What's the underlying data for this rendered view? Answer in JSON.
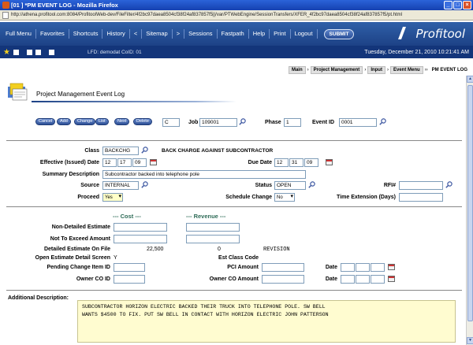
{
  "window": {
    "title": "[01 ] *PM EVENT LOG - Mozilla Firefox",
    "url": "http://athena.profitool.com:8084/ProfitoolWeb-dev/FileFilter/4f2bc97daea8504cf38f24af837857f5||/var/PTWebEngine/SessionTransfers/XFER_4f2bc97daea8504cf38f24af837857f5/pt.html"
  },
  "menu": {
    "items": [
      "Full Menu",
      "Favorites",
      "Shortcuts",
      "History",
      "<",
      "Sitemap",
      ">",
      "Sessions",
      "Fastpath",
      "Help",
      "Print",
      "Logout"
    ],
    "submit_label": "SUBMIT",
    "brand": "Profitool"
  },
  "userbar": {
    "lfd": "LFD: demodat  CoID: 01",
    "date": "Tuesday, December 21, 2010  10:21:41 AM"
  },
  "breadcrumb": [
    "Main",
    "Project Management",
    "Input",
    "Event Menu",
    "PM EVENT LOG"
  ],
  "form_title": "Project Management Event Log",
  "actions": [
    "Cancel",
    "Add",
    "Change",
    "List",
    "Next",
    "Delete"
  ],
  "header": {
    "mode_value": "C",
    "job_label": "Job",
    "job_value": "109001",
    "phase_label": "Phase",
    "phase_value": "1",
    "event_id_label": "Event ID",
    "event_id_value": "0001"
  },
  "details": {
    "class_label": "Class",
    "class_value": "BACKCHG",
    "class_desc": "BACK CHARGE AGAINST SUBCONTRACTOR",
    "effective_label": "Effective (Issued) Date",
    "effective": [
      "12",
      "17",
      "09"
    ],
    "due_label": "Due Date",
    "due": [
      "12",
      "31",
      "09"
    ],
    "summary_label": "Summary Description",
    "summary_value": "Subcontractor backed into telephone pole",
    "source_label": "Source",
    "source_value": "INTERNAL",
    "status_label": "Status",
    "status_value": "OPEN",
    "rfi_label": "RFI#",
    "rfi_value": "",
    "proceed_label": "Proceed",
    "proceed_value": "Yes",
    "schedule_label": "Schedule Change",
    "schedule_value": "No",
    "time_ext_label": "Time Extension (Days)",
    "time_ext_value": ""
  },
  "costs": {
    "cost_header": "--- Cost ---",
    "revenue_header": "--- Revenue ---",
    "non_detailed_label": "Non-Detailed Estimate",
    "nte_label": "Not To Exceed Amount",
    "detailed_label": "Detailed Estimate On File",
    "detailed_value": "22,500",
    "detailed_rev_value": "0",
    "revision_label": "REVISION",
    "open_screen_label": "Open Estimate Detail Screen",
    "open_screen_value": "Y",
    "est_class_label": "Est Class Code",
    "pending_label": "Pending Change Item ID",
    "pci_label": "PCI Amount",
    "date_label": "Date",
    "owner_co_id_label": "Owner CO ID",
    "owner_co_amt_label": "Owner CO Amount",
    "date2_label": "Date"
  },
  "additional": {
    "label": "Additional Description:",
    "text": "SUBCONTRACTOR HORIZON ELECTRIC BACKED THEIR TRUCK INTO TELEPHONE POLE. SW BELL\nWANTS $4500 TO FIX. PUT SW BELL IN CONTACT WITH HORIZON ELECTRIC JOHN PATTERSON"
  }
}
